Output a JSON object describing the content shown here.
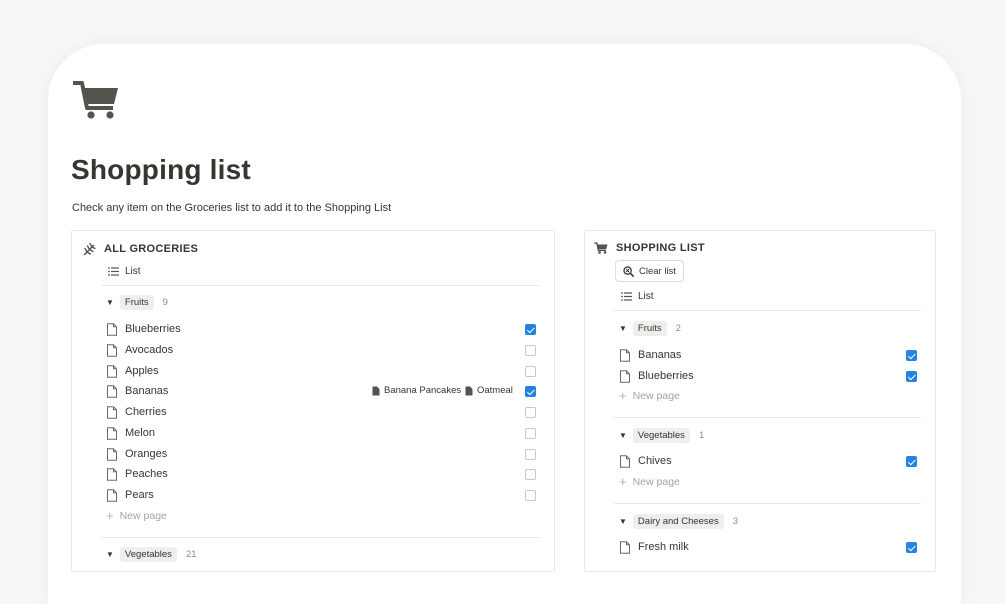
{
  "page": {
    "icon": "shopping-cart-icon",
    "title": "Shopping list",
    "description": "Check any item on the Groceries list to add it to the Shopping List"
  },
  "groceries": {
    "title": "ALL GROCERIES",
    "icon": "wheat-icon",
    "view_label": "List",
    "groups": [
      {
        "name": "Fruits",
        "count": "9",
        "items": [
          {
            "name": "Blueberries",
            "checked": true
          },
          {
            "name": "Avocados",
            "checked": false
          },
          {
            "name": "Apples",
            "checked": false
          },
          {
            "name": "Bananas",
            "checked": true,
            "relations": [
              "Banana Pancakes",
              "Oatmeal"
            ]
          },
          {
            "name": "Cherries",
            "checked": false
          },
          {
            "name": "Melon",
            "checked": false
          },
          {
            "name": "Oranges",
            "checked": false
          },
          {
            "name": "Peaches",
            "checked": false
          },
          {
            "name": "Pears",
            "checked": false
          }
        ],
        "new_page_label": "New page"
      },
      {
        "name": "Vegetables",
        "count": "21"
      }
    ]
  },
  "shopping": {
    "title": "SHOPPING LIST",
    "icon": "shopping-cart-icon",
    "clear_label": "Clear list",
    "view_label": "List",
    "groups": [
      {
        "name": "Fruits",
        "count": "2",
        "items": [
          {
            "name": "Bananas",
            "checked": true
          },
          {
            "name": "Blueberries",
            "checked": true
          }
        ],
        "new_page_label": "New page"
      },
      {
        "name": "Vegetables",
        "count": "1",
        "items": [
          {
            "name": "Chives",
            "checked": true
          }
        ],
        "new_page_label": "New page"
      },
      {
        "name": "Dairy and Cheeses",
        "count": "3",
        "items": [
          {
            "name": "Fresh milk",
            "checked": true
          }
        ]
      }
    ]
  },
  "colors": {
    "accent": "#2383e2",
    "text": "#37352f",
    "muted": "#a5a29c",
    "pill": "#efeeec"
  }
}
